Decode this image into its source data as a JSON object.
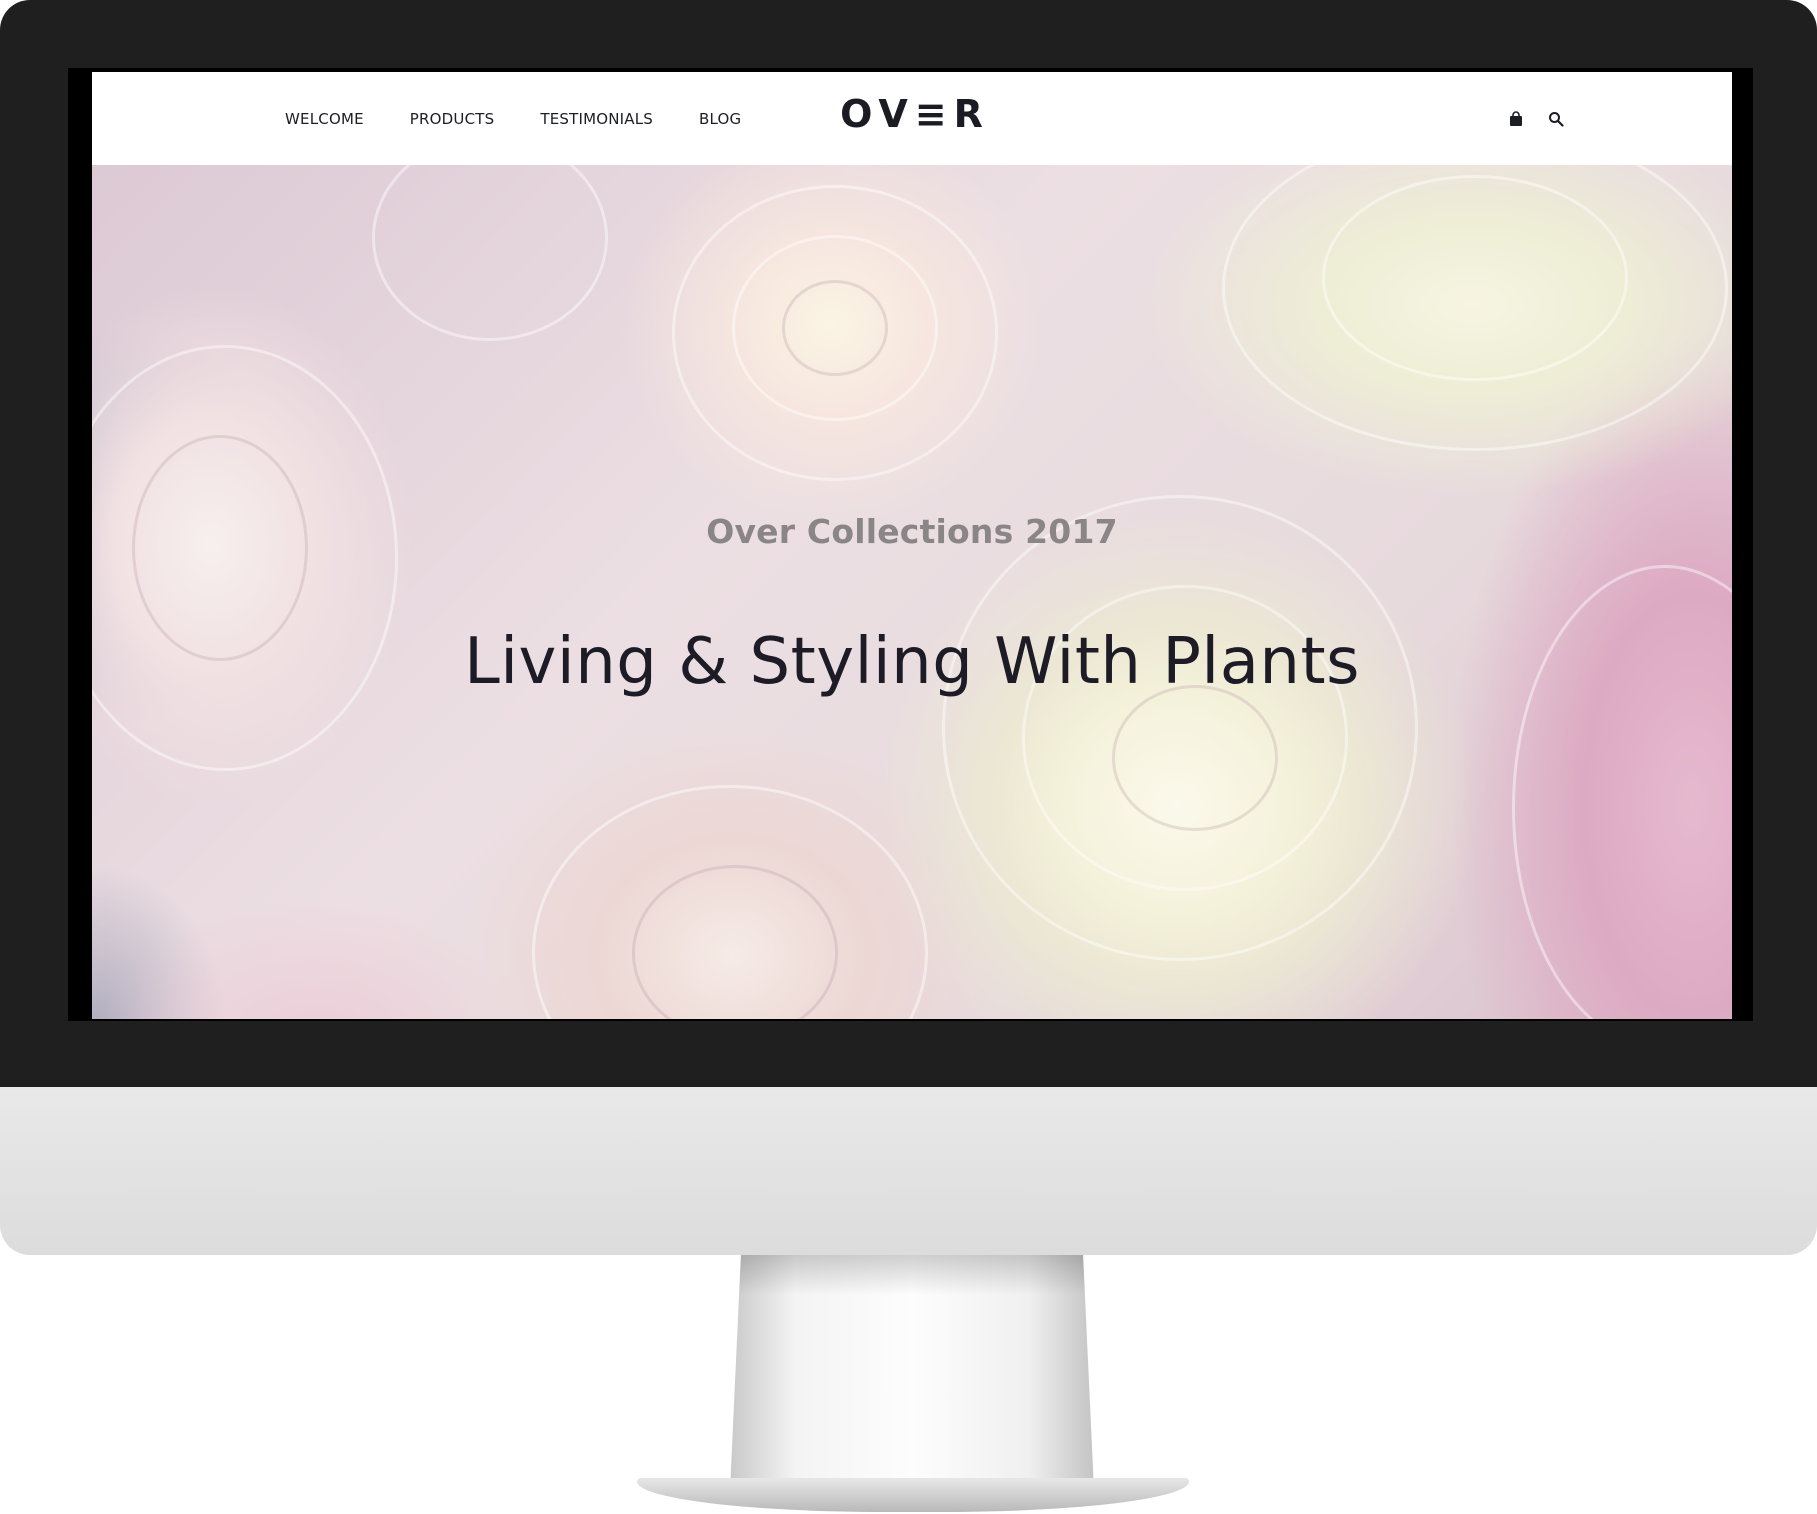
{
  "nav": {
    "items": [
      {
        "label": "WELCOME"
      },
      {
        "label": "PRODUCTS"
      },
      {
        "label": "TESTIMONIALS"
      },
      {
        "label": "BLOG"
      }
    ]
  },
  "brand": {
    "logo": "OV≡R"
  },
  "header_icons": [
    "shopping-bag-icon",
    "search-icon"
  ],
  "hero": {
    "subtitle": "Over Collections 2017",
    "title": "Living & Styling With Plants"
  },
  "colors": {
    "text_dark": "#1c1b26",
    "subtitle_gray": "#8a8688",
    "bezel": "#1f1f1f",
    "chin": "#e4e4e4"
  }
}
